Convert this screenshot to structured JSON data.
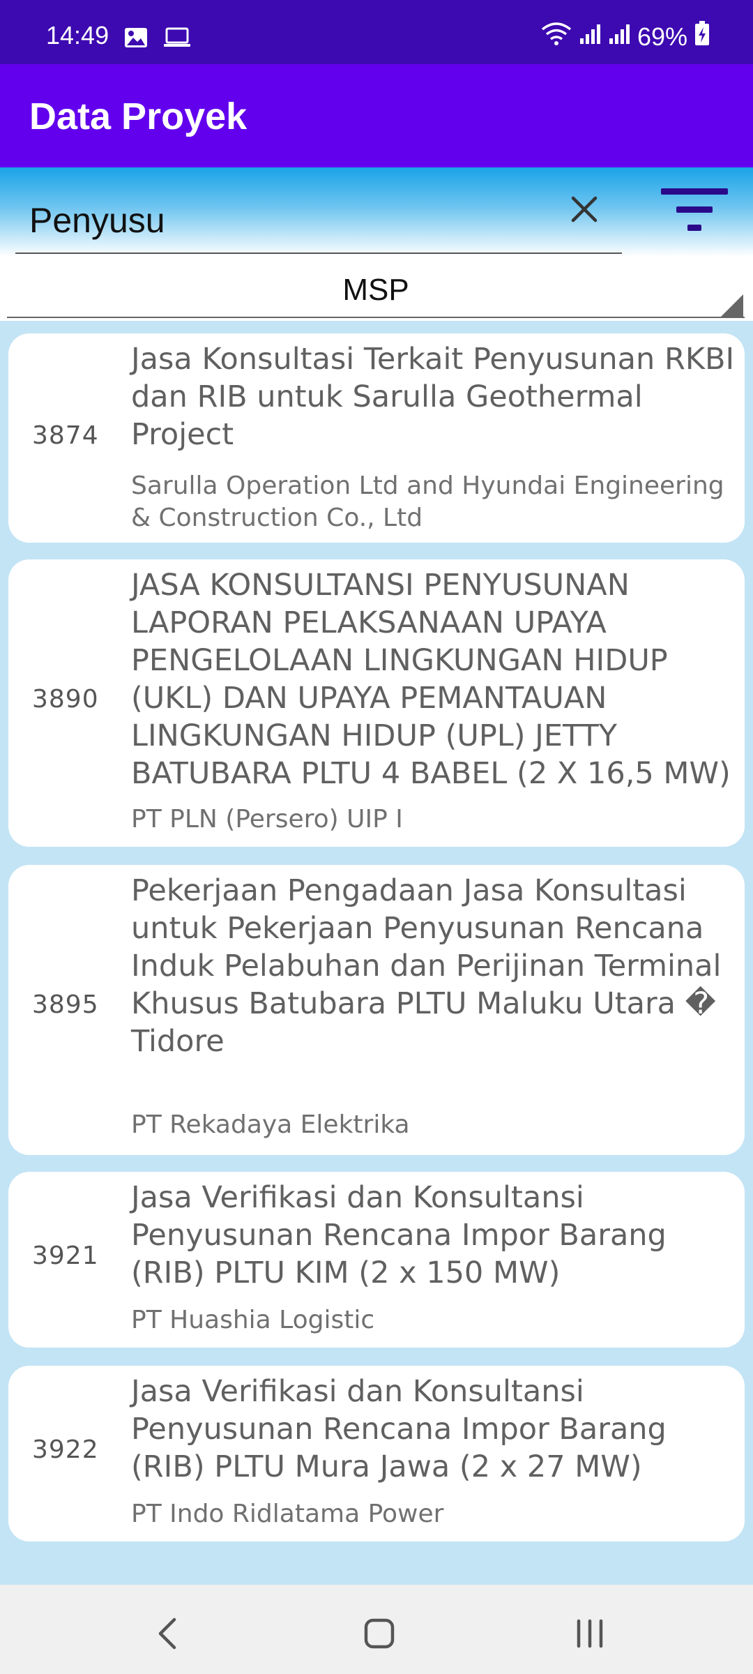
{
  "status_bar": {
    "time": "14:49",
    "battery": "69%",
    "icons": [
      "image-icon",
      "laptop-icon",
      "wifi-icon",
      "signal-icon",
      "signal-icon",
      "battery-charging-icon"
    ]
  },
  "app_bar": {
    "title": "Data Proyek"
  },
  "search": {
    "value": "Penyusu"
  },
  "filter": {
    "selected": "MSP"
  },
  "projects": [
    {
      "id": "3874",
      "title": "Jasa Konsultasi Terkait Penyusunan RKBI dan RIB untuk Sarulla Geothermal Project",
      "company": "Sarulla Operation Ltd and Hyundai Engineering & Construction Co., Ltd"
    },
    {
      "id": "3890",
      "title": "JASA KONSULTANSI PENYUSUNAN LAPORAN PELAKSANAAN UPAYA PENGELOLAAN LINGKUNGAN HIDUP (UKL) DAN UPAYA PEMANTAUAN LINGKUNGAN HIDUP (UPL) JETTY BATUBARA PLTU 4 BABEL (2 X 16,5 MW)",
      "company": "PT PLN (Persero) UIP I"
    },
    {
      "id": "3895",
      "title": "Pekerjaan Pengadaan Jasa Konsultasi untuk Pekerjaan Penyusunan Rencana Induk Pelabuhan dan Perijinan Terminal Khusus Batubara PLTU Maluku Utara � Tidore",
      "company": "PT Rekadaya Elektrika"
    },
    {
      "id": "3921",
      "title": "Jasa Verifikasi dan Konsultansi Penyusunan Rencana Impor Barang (RIB) PLTU KIM (2 x 150 MW)",
      "company": "PT Huashia Logistic"
    },
    {
      "id": "3922",
      "title": "Jasa Verifikasi dan Konsultansi Penyusunan Rencana Impor Barang (RIB) PLTU Mura Jawa (2 x 27 MW)",
      "company": "PT Indo Ridlatama Power"
    }
  ],
  "colors": {
    "status_bar": "#3d09b0",
    "app_bar": "#6200ee",
    "list_background": "#c3e4f5",
    "filter_icon": "#2a0a8a"
  }
}
